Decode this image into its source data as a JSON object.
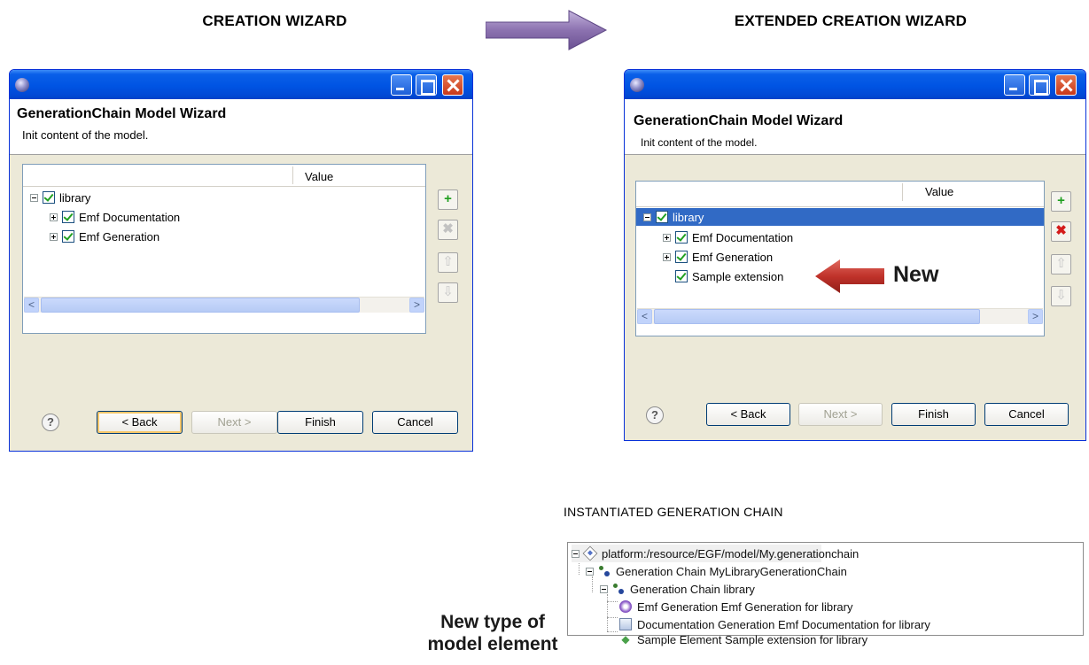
{
  "captions": {
    "left": "CREATION WIZARD",
    "right": "EXTENDED CREATION WIZARD",
    "bottom": "INSTANTIATED GENERATION CHAIN"
  },
  "wizard": {
    "title": "GenerationChain Model Wizard",
    "description": "Init content of the model.",
    "column_header": "Value",
    "root": "library",
    "items": [
      "Emf Documentation",
      "Emf Generation"
    ],
    "extension_item": "Sample extension",
    "buttons": {
      "help": "?",
      "back": "< Back",
      "next": "Next >",
      "finish": "Finish",
      "cancel": "Cancel"
    },
    "side_buttons": {
      "add": "+",
      "remove": "✖",
      "up": "⇧",
      "down": "⇩"
    },
    "scroll": {
      "left": "<",
      "right": ">",
      "grip": "|||"
    }
  },
  "annotations": {
    "new": "New",
    "new_type_line1": "New type of",
    "new_type_line2": "model element"
  },
  "result_tree": [
    "platform:/resource/EGF/model/My.generationchain",
    "Generation Chain MyLibraryGenerationChain",
    "Generation Chain library",
    "Emf Generation Emf Generation for library",
    "Documentation Generation Emf Documentation for library",
    "Sample Element Sample extension for library"
  ],
  "colors": {
    "titlebar": "#0054e3",
    "selection": "#316ac5",
    "annotation_arrow": "#c0322a",
    "purple_arrow": "#8064a2"
  }
}
